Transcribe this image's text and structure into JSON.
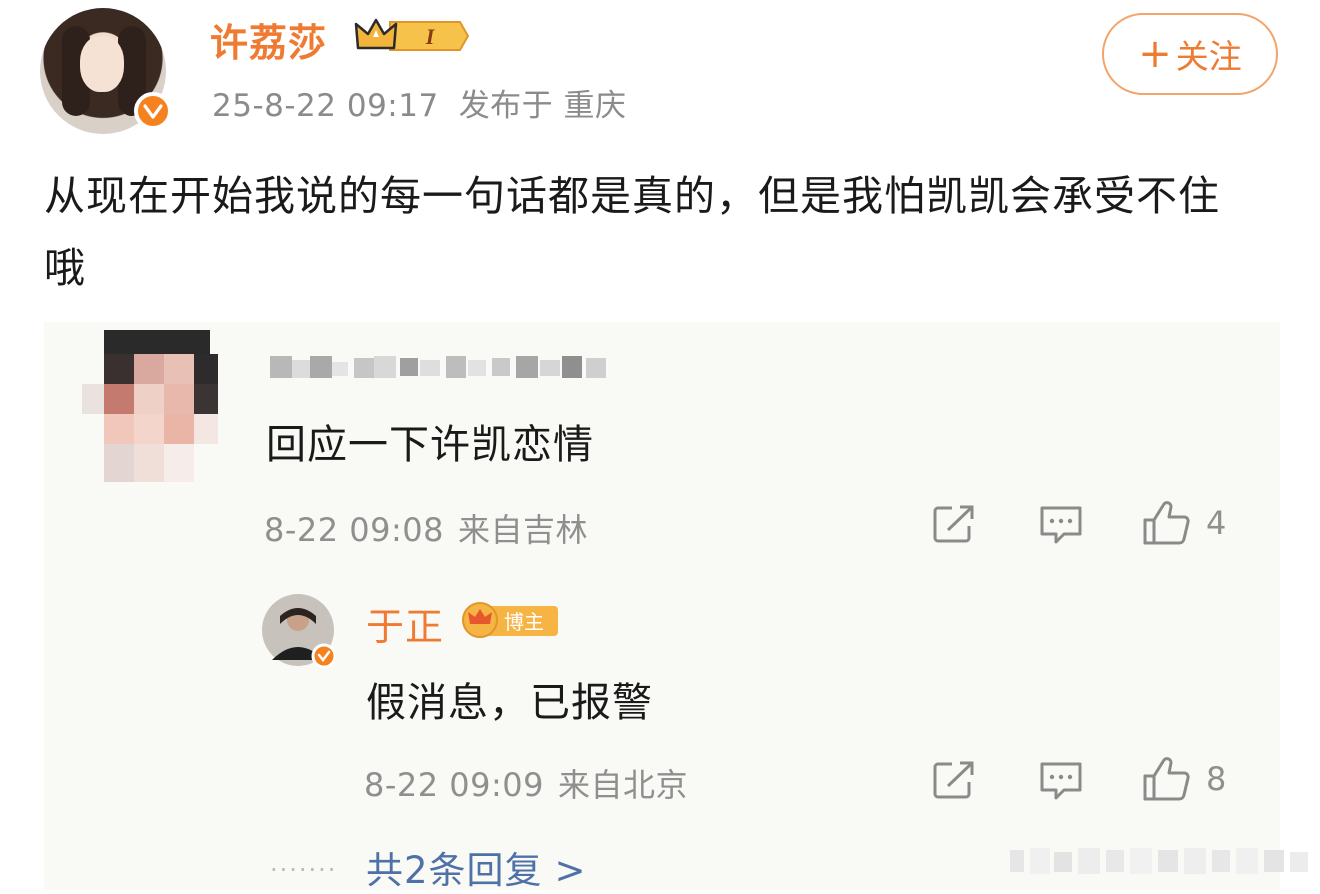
{
  "post": {
    "author_name": "许荔莎",
    "level_badge": "I",
    "timestamp": "25-8-22 09:17",
    "location": "发布于 重庆",
    "follow_label": "关注",
    "follow_plus": "+",
    "body": "从现在开始我说的每一句话都是真的，但是我怕凯凯会承受不住哦"
  },
  "comment": {
    "text": "回应一下许凯恋情",
    "time": "8-22 09:08",
    "location": "来自吉林",
    "like_count": "4"
  },
  "reply": {
    "author_name": "于正",
    "badge": "博主",
    "text": "假消息，已报警",
    "time": "8-22 09:09",
    "location": "来自北京",
    "like_count": "8"
  },
  "more": {
    "dots": "·······",
    "label": "共2条回复",
    "chevron": ">"
  },
  "icons": {
    "forward": "share-icon",
    "comment": "comment-icon",
    "like": "thumbs-up-icon",
    "verified": "verified-icon",
    "crown": "crown-icon"
  },
  "colors": {
    "accent_orange": "#ef7a32",
    "link_blue": "#4e71a8",
    "meta_gray": "#8f8f8f",
    "comment_bg": "#f9faf5"
  }
}
